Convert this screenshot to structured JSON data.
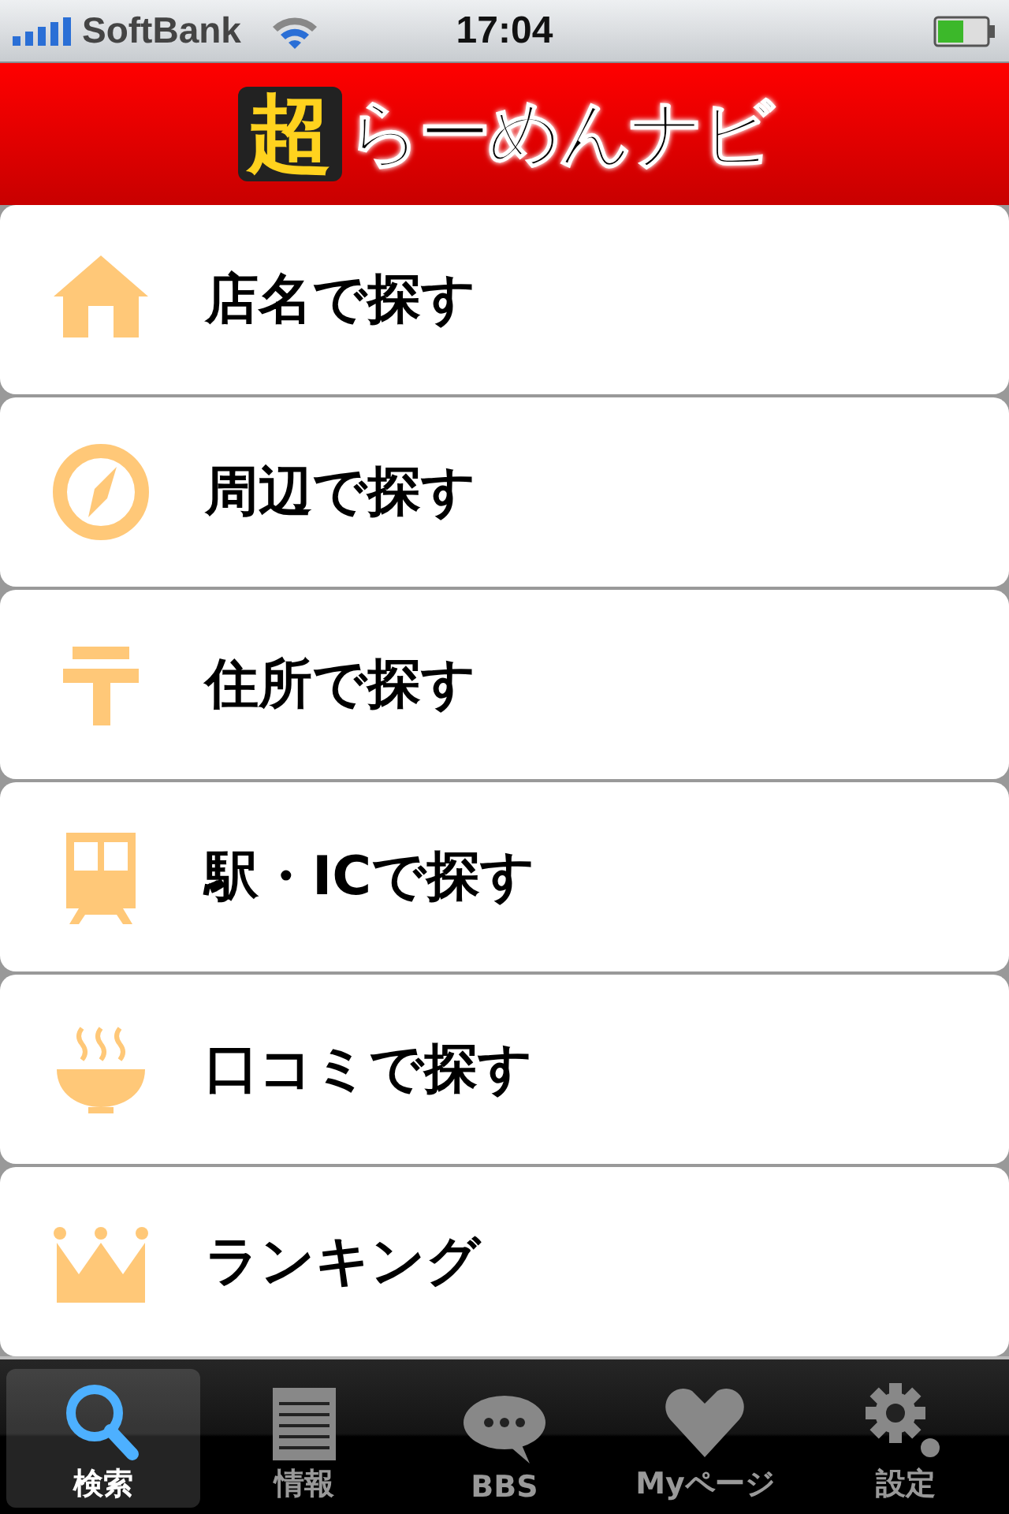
{
  "status_bar": {
    "carrier": "SoftBank",
    "time": "17:04"
  },
  "header": {
    "logo_mark": "超",
    "logo_text": "らーめんナビ"
  },
  "menu": [
    {
      "kind": "house",
      "label": "店名で探す"
    },
    {
      "kind": "compass",
      "label": "周辺で探す"
    },
    {
      "kind": "postal",
      "label": "住所で探す"
    },
    {
      "kind": "train",
      "label": "駅・ICで探す"
    },
    {
      "kind": "bowl",
      "label": "口コミで探す"
    },
    {
      "kind": "crown",
      "label": "ランキング"
    }
  ],
  "tabs": [
    {
      "kind": "search",
      "label": "検索",
      "selected": true
    },
    {
      "kind": "notepad",
      "label": "情報",
      "selected": false
    },
    {
      "kind": "bubble",
      "label": "BBS",
      "selected": false
    },
    {
      "kind": "heart",
      "label": "Myページ",
      "selected": false
    },
    {
      "kind": "gear",
      "label": "設定",
      "selected": false
    }
  ]
}
